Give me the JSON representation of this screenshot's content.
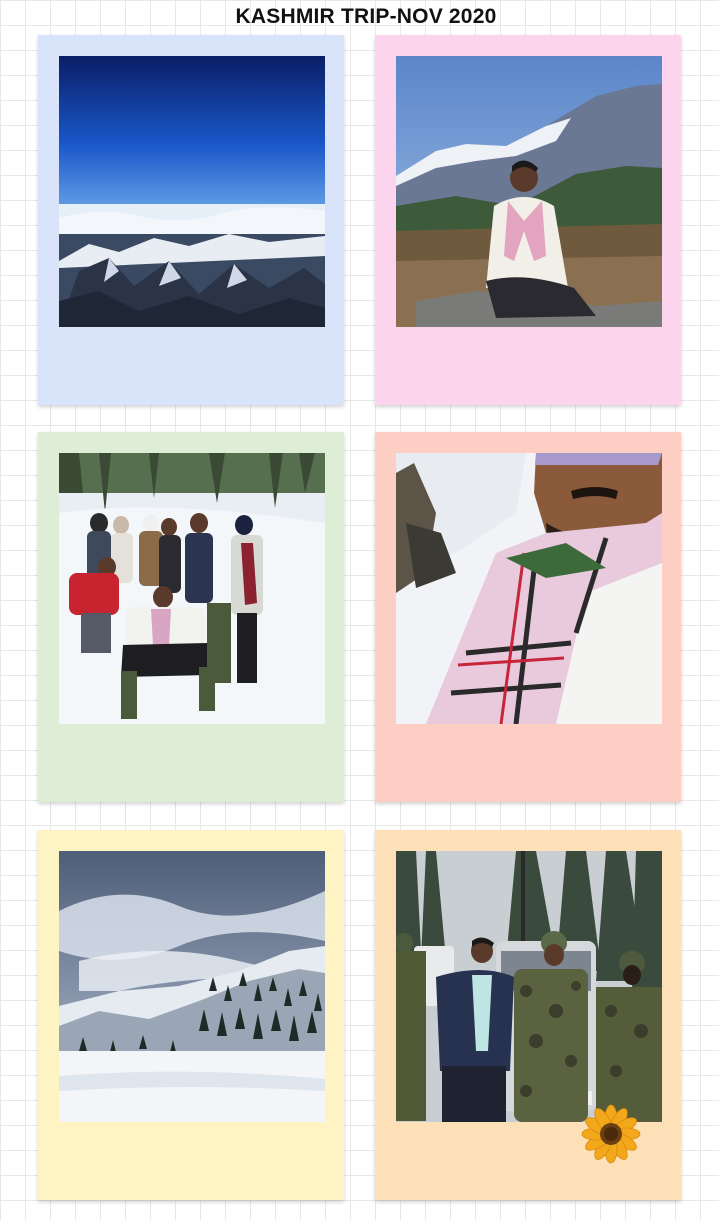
{
  "page": {
    "title": "KASHMIR TRIP-NOV 2020"
  },
  "cards": [
    {
      "frame_color": "#d9e4fb",
      "photo": "sky and snowy mountains seen from airplane"
    },
    {
      "frame_color": "#fdd4ee",
      "photo": "man seated on rock in front of snow mountains"
    },
    {
      "frame_color": "#deeed6",
      "photo": "group posing in snow among pine trees"
    },
    {
      "frame_color": "#fdcfc4",
      "photo": "selfie wearing checked scarf and sunglasses"
    },
    {
      "frame_color": "#fdf3c3",
      "photo": "snow covered mountain slopes under cloudy sky"
    },
    {
      "frame_color": "#fde0b8",
      "photo": "man standing with soldiers beside jeep"
    }
  ],
  "decorations": {
    "sticker": "sunflower-icon"
  }
}
